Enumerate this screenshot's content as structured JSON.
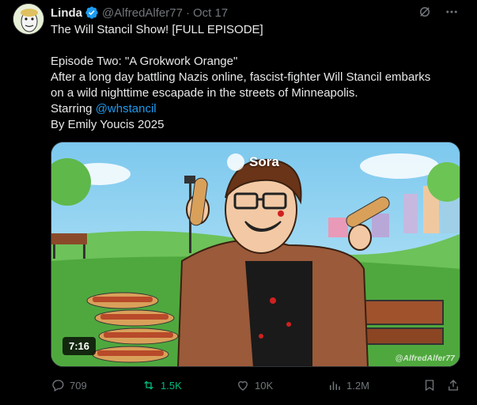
{
  "author": {
    "name": "Linda",
    "handle": "@AlfredAlfer77",
    "separator": "·",
    "date": "Oct 17"
  },
  "post": {
    "line1": "The Will Stancil Show! [FULL EPISODE]",
    "line2": "Episode Two: \"A Grokwork Orange\"",
    "line3": "After a long day battling Nazis online, fascist-fighter Will Stancil embarks",
    "line4": "on a wild nighttime escapade in the streets of Minneapolis.",
    "starring_prefix": "Starring ",
    "starring_mention": "@whstancil",
    "line6": "By Emily Youcis 2025"
  },
  "media": {
    "duration": "7:16",
    "sora_label": "Sora",
    "watermark": "@AlfredAlfer77"
  },
  "stats": {
    "replies": "709",
    "reposts": "1.5K",
    "likes": "10K",
    "views": "1.2M"
  },
  "colors": {
    "accent": "#1d9bf0",
    "repost": "#00ba7c",
    "muted": "#71767b",
    "background": "#000000"
  },
  "icons": [
    "verified-badge-icon",
    "grok-icon",
    "more-icon",
    "reply-icon",
    "repost-icon",
    "like-icon",
    "views-icon",
    "bookmark-icon",
    "share-icon"
  ]
}
